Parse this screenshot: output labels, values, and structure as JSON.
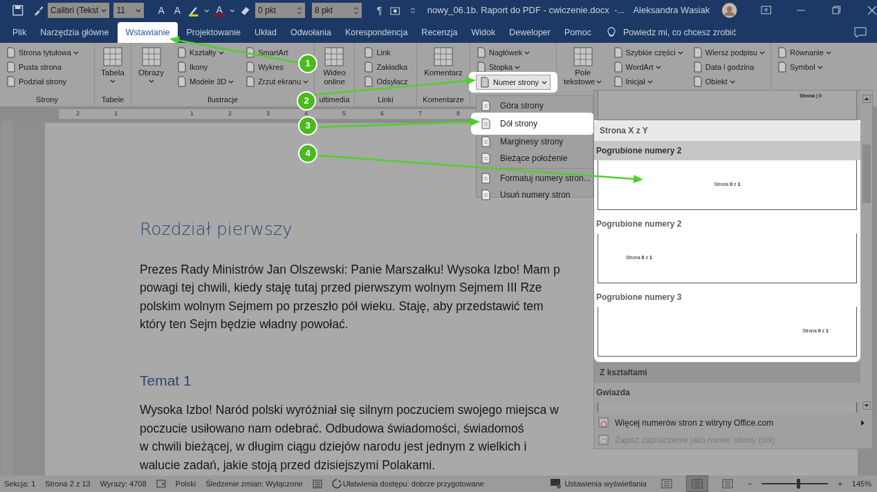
{
  "title_bar": {
    "font": "Calibri (Tekst",
    "font_size": "11",
    "grow_font": "A",
    "shrink_font": "A",
    "font_color": "A",
    "spacing_before": "0 pkt",
    "spacing_after": "8 pkt",
    "paragraph_mark": "¶",
    "document_title": "nowy_06.1b. Raport do PDF - cwiczenie.docx  -...",
    "user": "Aleksandra Wasiak"
  },
  "tabs": [
    {
      "label": "Plik",
      "selected": false
    },
    {
      "label": "Narzędzia główne",
      "selected": false
    },
    {
      "label": "Wstawianie",
      "selected": true
    },
    {
      "label": "Projektowanie",
      "selected": false
    },
    {
      "label": "Układ",
      "selected": false
    },
    {
      "label": "Odwołania",
      "selected": false
    },
    {
      "label": "Korespondencja",
      "selected": false
    },
    {
      "label": "Recenzja",
      "selected": false
    },
    {
      "label": "Widok",
      "selected": false
    },
    {
      "label": "Deweloper",
      "selected": false
    },
    {
      "label": "Pomoc",
      "selected": false
    }
  ],
  "tell_me": "Powiedz mi, co chcesz zrobić",
  "ribbon": [
    {
      "label": "Strony",
      "columns": [
        {
          "kind": "small",
          "items": [
            {
              "label": "Strona tytułowa",
              "dropdown": true,
              "highlighted": false
            },
            {
              "label": "Pusta strona",
              "dropdown": false,
              "highlighted": false
            },
            {
              "label": "Podział strony",
              "dropdown": false,
              "highlighted": false
            }
          ]
        }
      ]
    },
    {
      "label": "Tabele",
      "columns": [
        {
          "kind": "large",
          "label": "Tabela",
          "dropdown": true
        }
      ]
    },
    {
      "label": "Ilustracje",
      "columns": [
        {
          "kind": "large",
          "label": "Obrazy",
          "dropdown": true
        },
        {
          "kind": "small",
          "items": [
            {
              "label": "Kształty",
              "dropdown": true,
              "highlighted": false
            },
            {
              "label": "Ikony",
              "dropdown": false,
              "highlighted": false
            },
            {
              "label": "Modele 3D",
              "dropdown": true,
              "highlighted": false
            }
          ]
        },
        {
          "kind": "small",
          "items": [
            {
              "label": "SmartArt",
              "dropdown": false,
              "highlighted": false
            },
            {
              "label": "Wykres",
              "dropdown": false,
              "highlighted": false
            },
            {
              "label": "Zrzut ekranu",
              "dropdown": true,
              "highlighted": false
            }
          ]
        }
      ]
    },
    {
      "label": "ultimedia",
      "columns": [
        {
          "kind": "large",
          "label": "Wideo\nonline",
          "dropdown": false
        }
      ]
    },
    {
      "label": "Linki",
      "columns": [
        {
          "kind": "small",
          "items": [
            {
              "label": "Link",
              "dropdown": false,
              "highlighted": false
            },
            {
              "label": "Zakładka",
              "dropdown": false,
              "highlighted": false
            },
            {
              "label": "Odsyłacz",
              "dropdown": false,
              "highlighted": false
            }
          ]
        }
      ]
    },
    {
      "label": "Komentarze",
      "columns": [
        {
          "kind": "large",
          "label": "Komentarz",
          "dropdown": false
        }
      ]
    },
    {
      "columns": [
        {
          "kind": "small",
          "items": [
            {
              "label": "Nagłówek",
              "dropdown": true,
              "highlighted": false
            },
            {
              "label": "Stopka",
              "dropdown": true,
              "highlighted": false
            },
            {
              "label": "Numer strony",
              "dropdown": true,
              "highlighted": true
            }
          ]
        }
      ]
    },
    {
      "columns": [
        {
          "kind": "large",
          "label": "Pole\ntekstowe",
          "dropdown": true
        },
        {
          "kind": "small",
          "items": [
            {
              "label": "Szybkie części",
              "dropdown": true,
              "highlighted": false
            },
            {
              "label": "WordArt",
              "dropdown": true,
              "highlighted": false
            },
            {
              "label": "Inicjał",
              "dropdown": true,
              "highlighted": false
            }
          ]
        },
        {
          "kind": "small",
          "items": [
            {
              "label": "Wiersz podpisu",
              "dropdown": true,
              "highlighted": false
            },
            {
              "label": "Data i godzina",
              "dropdown": false,
              "highlighted": false
            },
            {
              "label": "Obiekt",
              "dropdown": true,
              "highlighted": false
            }
          ]
        }
      ]
    },
    {
      "columns": [
        {
          "kind": "small",
          "items": [
            {
              "label": "Równanie",
              "dropdown": true,
              "highlighted": false
            },
            {
              "label": "Symbol",
              "dropdown": true,
              "highlighted": false
            }
          ]
        }
      ]
    }
  ],
  "ruler": {
    "left_marks": [
      "2",
      "1"
    ],
    "right_marks": [
      "1",
      "2",
      "3",
      "4",
      "5",
      "6",
      "7",
      "8"
    ]
  },
  "document": {
    "heading": "Rozdział pierwszy",
    "paragraph_1": [
      "Prezes Rady Ministrów Jan Olszewski: Panie Marszałku! Wysoka Izbo! Mam p",
      "powagi tej chwili, kiedy staję tutaj przed pierwszym wolnym Sejmem III Rze",
      "polskim wolnym Sejmem po przeszło pół wieku. Staję, aby przedstawić tem",
      "który ten Sejm będzie władny powołać."
    ],
    "subheading": "Temat 1",
    "paragraph_2": [
      "Wysoka Izbo! Naród polski wyróżniał się silnym poczuciem swojego miejsca w",
      "poczucie usiłowano nam odebrać. Odbudowa świadomości, świadomoś",
      "w chwili bieżącej, w długim ciągu dziejów narodu jest jednym z wielkich i",
      "walucie zadań, jakie stoją przed dzisiejszymi Polakami."
    ]
  },
  "page_number_menu": [
    {
      "label": "Góra strony",
      "highlighted": false
    },
    {
      "label": "Dół strony",
      "highlighted": true
    },
    {
      "label": "Marginesy strony",
      "highlighted": false
    },
    {
      "label": "Bieżące położenie",
      "highlighted": false
    },
    {
      "label": "Formatuj numery stron...",
      "highlighted": false
    },
    {
      "label": "Usuń numery stron",
      "highlighted": false
    }
  ],
  "gallery": {
    "top_preview": "Strona | 0",
    "entries": [
      {
        "kind": "section",
        "label": "Strona X z Y",
        "highlighted": true
      },
      {
        "kind": "item",
        "label": "Pogrubione numery 2",
        "preview": "Strona **0** z **1**",
        "selected": true,
        "highlighted": true
      },
      {
        "kind": "item",
        "label": "Pogrubione numery 2",
        "preview": "Strona **0** z **1**",
        "selected": false,
        "highlighted": true
      },
      {
        "kind": "item",
        "label": "Pogrubione numery 3",
        "preview": "Strona **0** z **1**",
        "selected": false,
        "highlighted": true
      },
      {
        "kind": "section",
        "label": "Z kształtami",
        "highlighted": false
      },
      {
        "kind": "item",
        "label": "Gwiazda",
        "selected": false,
        "highlighted": false
      }
    ],
    "footer": [
      {
        "label": "Więcej numerów stron z witryny Office.com",
        "disabled": false,
        "submenu": true
      },
      {
        "label": "Zapisz zaznaczenie jako numer strony (dół)",
        "disabled": true,
        "submenu": false
      }
    ]
  },
  "callouts": [
    "1",
    "2",
    "3",
    "4"
  ],
  "status_bar": {
    "left": [
      "Sekcja: 1",
      "Strona 2 z 13",
      "Wyrazy: 4708",
      "Polski",
      "Śledzenie zmian: Wyłączone",
      "Ułatwienia dostępu: dobrze przygotowane"
    ],
    "display_settings": "Ustawienia wyświetlania",
    "views": [
      {
        "selected": false
      },
      {
        "selected": true
      },
      {
        "selected": false
      }
    ],
    "zoom_out": "−",
    "zoom_in": "+",
    "zoom": {
      "level": 0.55
    },
    "zoom_label": "145%"
  }
}
